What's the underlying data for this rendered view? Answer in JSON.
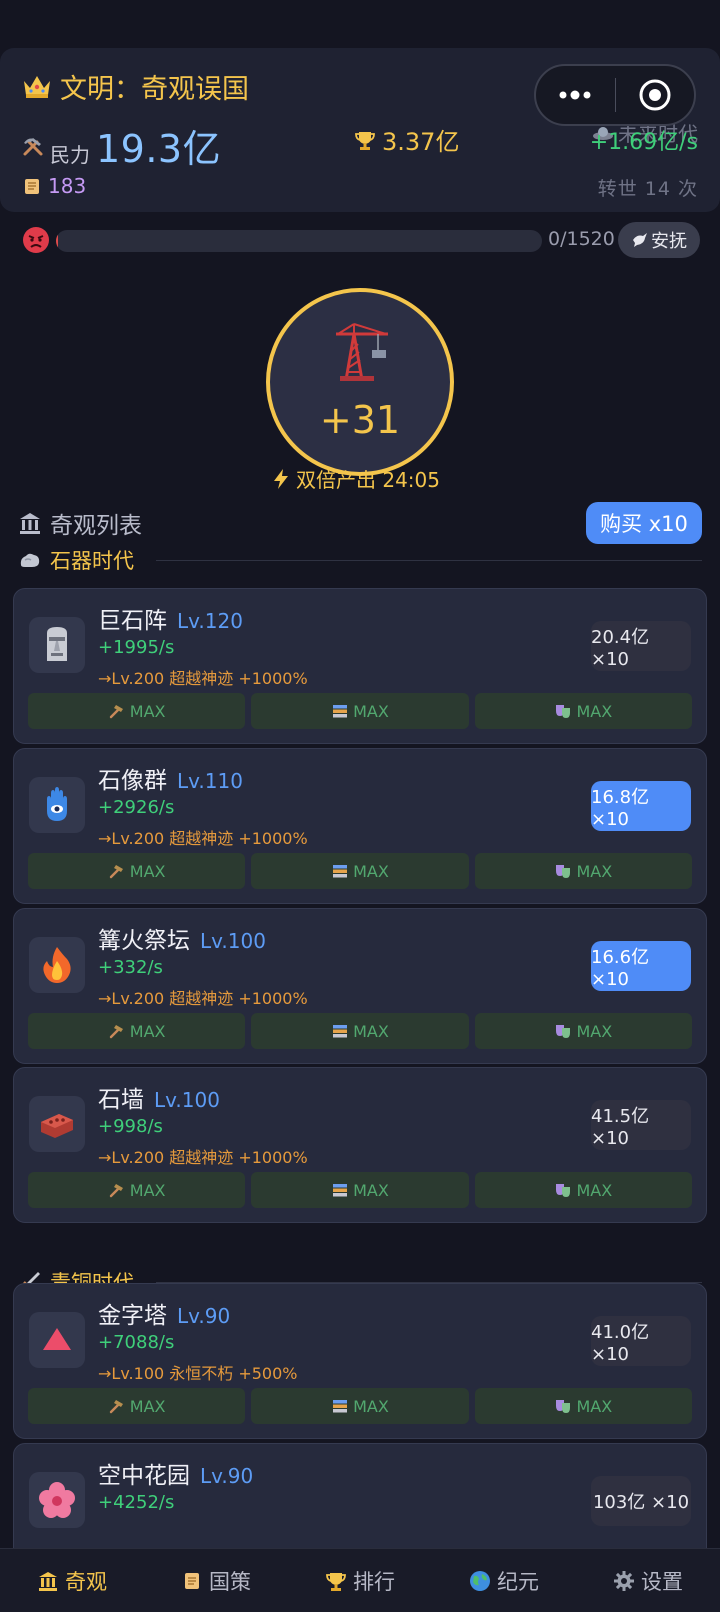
{
  "header": {
    "title": "文明：奇观误国",
    "era": "未来时代",
    "power_label": "民力",
    "power_value": "19.3亿",
    "trophy_value": "3.37亿",
    "rate": "+1.69亿/s",
    "scrolls": "183",
    "rebirth": "转世 14 次"
  },
  "anger": {
    "count": "0/1520",
    "progress": 0,
    "soothe_label": "安抚"
  },
  "tap": {
    "value": "+31",
    "boost": "双倍产出 24:05"
  },
  "list": {
    "title": "奇观列表",
    "buy_multiplier": "购买 x10"
  },
  "eras": [
    {
      "name": "石器时代"
    },
    {
      "name": "青铜时代"
    }
  ],
  "wonders": [
    {
      "name": "巨石阵",
      "level": "Lv.120",
      "prod": "+1995/s",
      "milestone": "→Lv.200 超越神迹 +1000%",
      "cost": "20.4亿 ×10",
      "affordable": false,
      "icon": "moai-icon",
      "upgrades": [
        "MAX",
        "MAX",
        "MAX"
      ]
    },
    {
      "name": "石像群",
      "level": "Lv.110",
      "prod": "+2926/s",
      "milestone": "→Lv.200 超越神迹 +1000%",
      "cost": "16.8亿 ×10",
      "affordable": true,
      "icon": "hamsa-icon",
      "upgrades": [
        "MAX",
        "MAX",
        "MAX"
      ]
    },
    {
      "name": "篝火祭坛",
      "level": "Lv.100",
      "prod": "+332/s",
      "milestone": "→Lv.200 超越神迹 +1000%",
      "cost": "16.6亿 ×10",
      "affordable": true,
      "icon": "fire-icon",
      "upgrades": [
        "MAX",
        "MAX",
        "MAX"
      ]
    },
    {
      "name": "石墙",
      "level": "Lv.100",
      "prod": "+998/s",
      "milestone": "→Lv.200 超越神迹 +1000%",
      "cost": "41.5亿 ×10",
      "affordable": false,
      "icon": "brick-icon",
      "upgrades": [
        "MAX",
        "MAX",
        "MAX"
      ]
    },
    {
      "name": "金字塔",
      "level": "Lv.90",
      "prod": "+7088/s",
      "milestone": "→Lv.100 永恒不朽 +500%",
      "cost": "41.0亿 ×10",
      "affordable": false,
      "icon": "pyramid-icon",
      "upgrades": [
        "MAX",
        "MAX",
        "MAX"
      ]
    },
    {
      "name": "空中花园",
      "level": "Lv.90",
      "prod": "+4252/s",
      "milestone": "",
      "cost": "103亿 ×10",
      "affordable": false,
      "icon": "hibiscus-icon",
      "upgrades": []
    }
  ],
  "tabs": [
    {
      "label": "奇观",
      "icon": "bank-icon"
    },
    {
      "label": "国策",
      "icon": "scroll-icon"
    },
    {
      "label": "排行",
      "icon": "trophy-icon"
    },
    {
      "label": "纪元",
      "icon": "globe-icon"
    },
    {
      "label": "设置",
      "icon": "gear-icon"
    }
  ],
  "colors": {
    "accent_gold": "#f4c54c",
    "accent_blue": "#4f8cf7",
    "prod_green": "#3fcf7a",
    "milestone_orange": "#e69a3c"
  }
}
